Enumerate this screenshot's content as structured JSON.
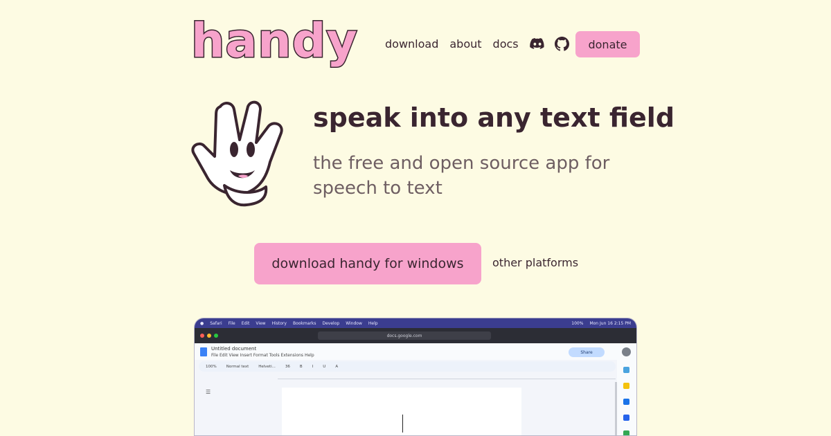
{
  "brand": {
    "logo_text": "handy",
    "color": "#f7a3cb",
    "ink": "#3a2530",
    "background": "#fdfbe3"
  },
  "nav": {
    "links": [
      "download",
      "about",
      "docs"
    ],
    "icons": [
      "discord-icon",
      "github-icon"
    ],
    "donate_label": "donate"
  },
  "hero": {
    "headline": "speak into any text field",
    "subline": "the free and open source app for speech to text",
    "mascot": "waving-hand-mascot"
  },
  "cta": {
    "primary_label": "download handy for windows",
    "secondary_label": "other platforms"
  },
  "screenshot": {
    "mac_menu": [
      "Safari",
      "File",
      "Edit",
      "View",
      "History",
      "Bookmarks",
      "Develop",
      "Window",
      "Help"
    ],
    "mac_status": [
      "100%",
      "Mon Jun 16 2:15 PM"
    ],
    "url": "docs.google.com",
    "doc_title": "Untitled document",
    "doc_menu": "File  Edit  View  Insert  Format  Tools  Extensions  Help",
    "share_label": "Share",
    "toolbar": [
      "100%",
      "Normal text",
      "Helveti...",
      "36",
      "B",
      "I",
      "U",
      "A"
    ]
  }
}
